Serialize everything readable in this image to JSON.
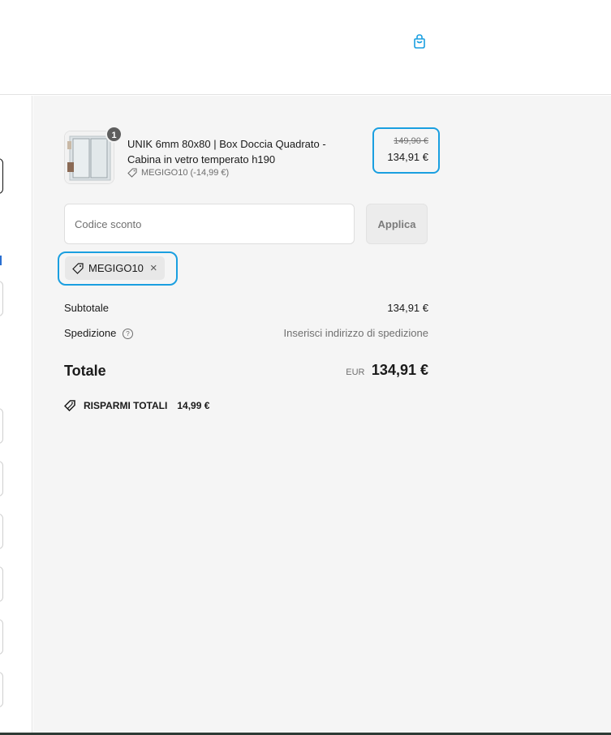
{
  "product": {
    "quantity": "1",
    "title": "UNIK 6mm 80x80 | Box Doccia Quadrato - Cabina in vetro temperato h190",
    "discount_applied": "MEGIGO10 (-14,99 €)",
    "price_original": "149,90 €",
    "price_discounted": "134,91 €"
  },
  "discount": {
    "placeholder": "Codice sconto",
    "apply_label": "Applica",
    "applied_code": "MEGIGO10"
  },
  "totals": {
    "subtotal_label": "Subtotale",
    "subtotal_value": "134,91 €",
    "shipping_label": "Spedizione",
    "shipping_value": "Inserisci indirizzo di spedizione",
    "total_label": "Totale",
    "total_currency": "EUR",
    "total_value": "134,91 €",
    "savings_label": "RISPARMI TOTALI",
    "savings_value": "14,99 €"
  },
  "icons": {
    "cart": "shopping-bag-icon",
    "tag": "tag-icon",
    "help": "help-circle-icon",
    "close": "close-icon"
  },
  "colors": {
    "highlight": "#1a9fe0",
    "summary_bg": "#f5f5f5",
    "footer_bar": "#2e3b35"
  }
}
